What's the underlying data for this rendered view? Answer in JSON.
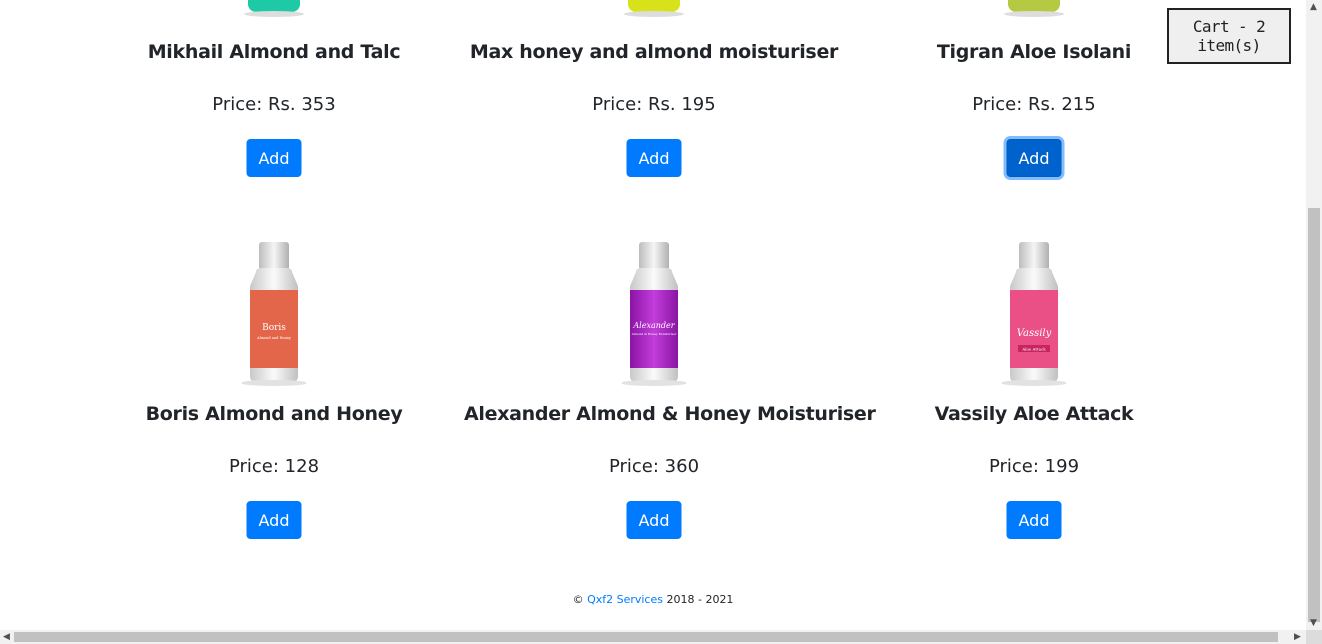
{
  "cart": {
    "label": "Cart - 2 item(s)"
  },
  "products": [
    {
      "name": "Mikhail Almond and Talc",
      "price": "Price: Rs. 353",
      "button": "Add",
      "color": "#1ec9a5"
    },
    {
      "name": "Max honey and almond moisturiser",
      "price": "Price: Rs. 195",
      "button": "Add",
      "color": "#d8e21a"
    },
    {
      "name": "Tigran Aloe Isolani",
      "price": "Price: Rs. 215",
      "button": "Add",
      "color": "#b5c943"
    },
    {
      "name": "Boris Almond and Honey",
      "price": "Price: 128",
      "button": "Add",
      "color": "#e4664a",
      "bottle_text": "Boris",
      "bottle_sub": "Almond and Honey"
    },
    {
      "name": "Alexander Almond & Honey Moisturiser",
      "price": "Price: 360",
      "button": "Add",
      "color": "#a51dbd",
      "bottle_text": "Alexander",
      "bottle_sub": "Almond & Honey Moisturiser"
    },
    {
      "name": "Vassily Aloe Attack",
      "price": "Price: 199",
      "button": "Add",
      "color": "#ea4f86",
      "bottle_text": "Vassily",
      "bottle_sub": "Aloe Attack"
    }
  ],
  "footer": {
    "copyright": "©",
    "company": "Qxf2 Services",
    "years": "2018 - 2021"
  },
  "colors": {
    "primary": "#007bff",
    "primary_active": "#0062cc"
  }
}
